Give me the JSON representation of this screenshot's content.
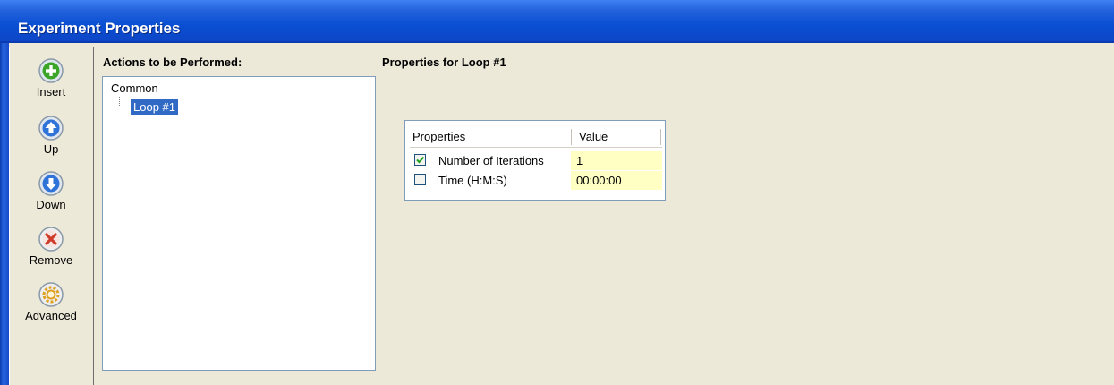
{
  "window": {
    "title": "Experiment Properties"
  },
  "toolbar": {
    "items": [
      {
        "label": "Insert",
        "icon": "plus-circle-icon",
        "color": "#3aa526"
      },
      {
        "label": "Up",
        "icon": "arrow-up-circle-icon",
        "color": "#2f73d8"
      },
      {
        "label": "Down",
        "icon": "arrow-down-circle-icon",
        "color": "#2f73d8"
      },
      {
        "label": "Remove",
        "icon": "x-circle-icon",
        "color": "#d03a2a"
      },
      {
        "label": "Advanced",
        "icon": "gear-circle-icon",
        "color": "#e0a020"
      }
    ]
  },
  "actions": {
    "heading": "Actions to be Performed:",
    "tree": {
      "root": "Common",
      "children": [
        {
          "label": "Loop #1",
          "selected": true
        }
      ]
    }
  },
  "properties": {
    "heading": "Properties for Loop #1",
    "columns": [
      "Properties",
      "Value"
    ],
    "rows": [
      {
        "name": "Number of Iterations",
        "value": "1",
        "checked": true
      },
      {
        "name": "Time (H:M:S)",
        "value": "00:00:00",
        "checked": false
      }
    ]
  },
  "colors": {
    "selection": "#316ac5",
    "value_cell": "#ffffc4",
    "titlebar": "#0a4fd3"
  }
}
